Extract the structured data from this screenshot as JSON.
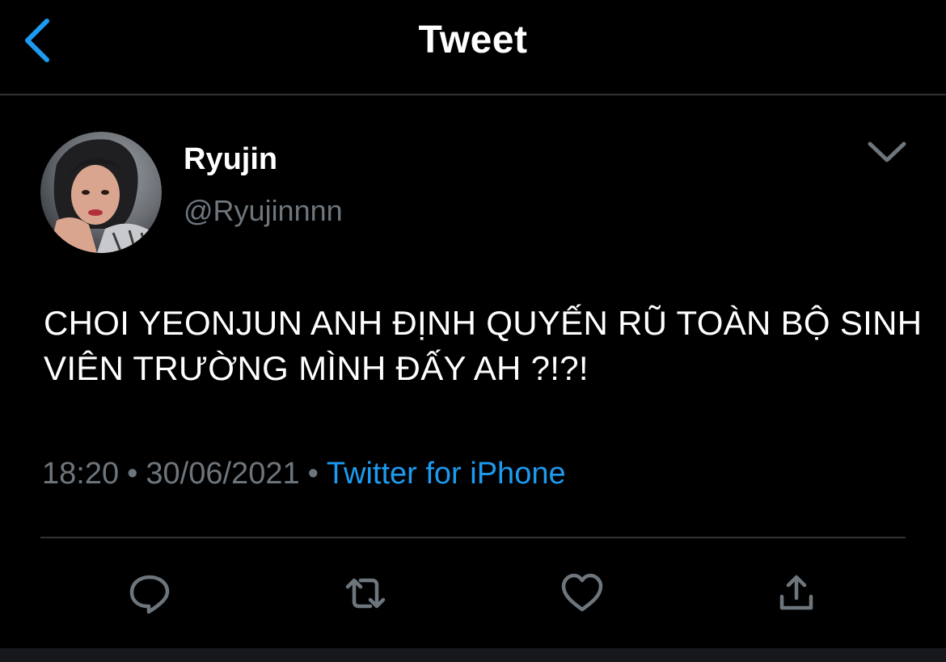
{
  "nav": {
    "title": "Tweet",
    "back_icon": "chevron-left-icon",
    "accent_color": "#1d9bf0"
  },
  "tweet": {
    "author": {
      "display_name": "Ryujin",
      "handle": "@Ryujinnnn",
      "avatar_icon": "profile-photo"
    },
    "menu_icon": "chevron-down-icon",
    "text": "CHOI YEONJUN ANH ĐỊNH QUYẾN RŨ TOÀN BỘ SINH VIÊN TRƯỜNG MÌNH ĐẤY AH ?!?!",
    "time": "18:20",
    "separator": "•",
    "date": "30/06/2021",
    "source": "Twitter for iPhone"
  },
  "actions": [
    {
      "icon": "reply-icon"
    },
    {
      "icon": "retweet-icon"
    },
    {
      "icon": "like-icon"
    },
    {
      "icon": "share-icon"
    }
  ],
  "colors": {
    "background": "#000000",
    "text": "#ffffff",
    "muted": "#6e767d",
    "divider": "#2f3336",
    "link": "#1d9bf0"
  }
}
